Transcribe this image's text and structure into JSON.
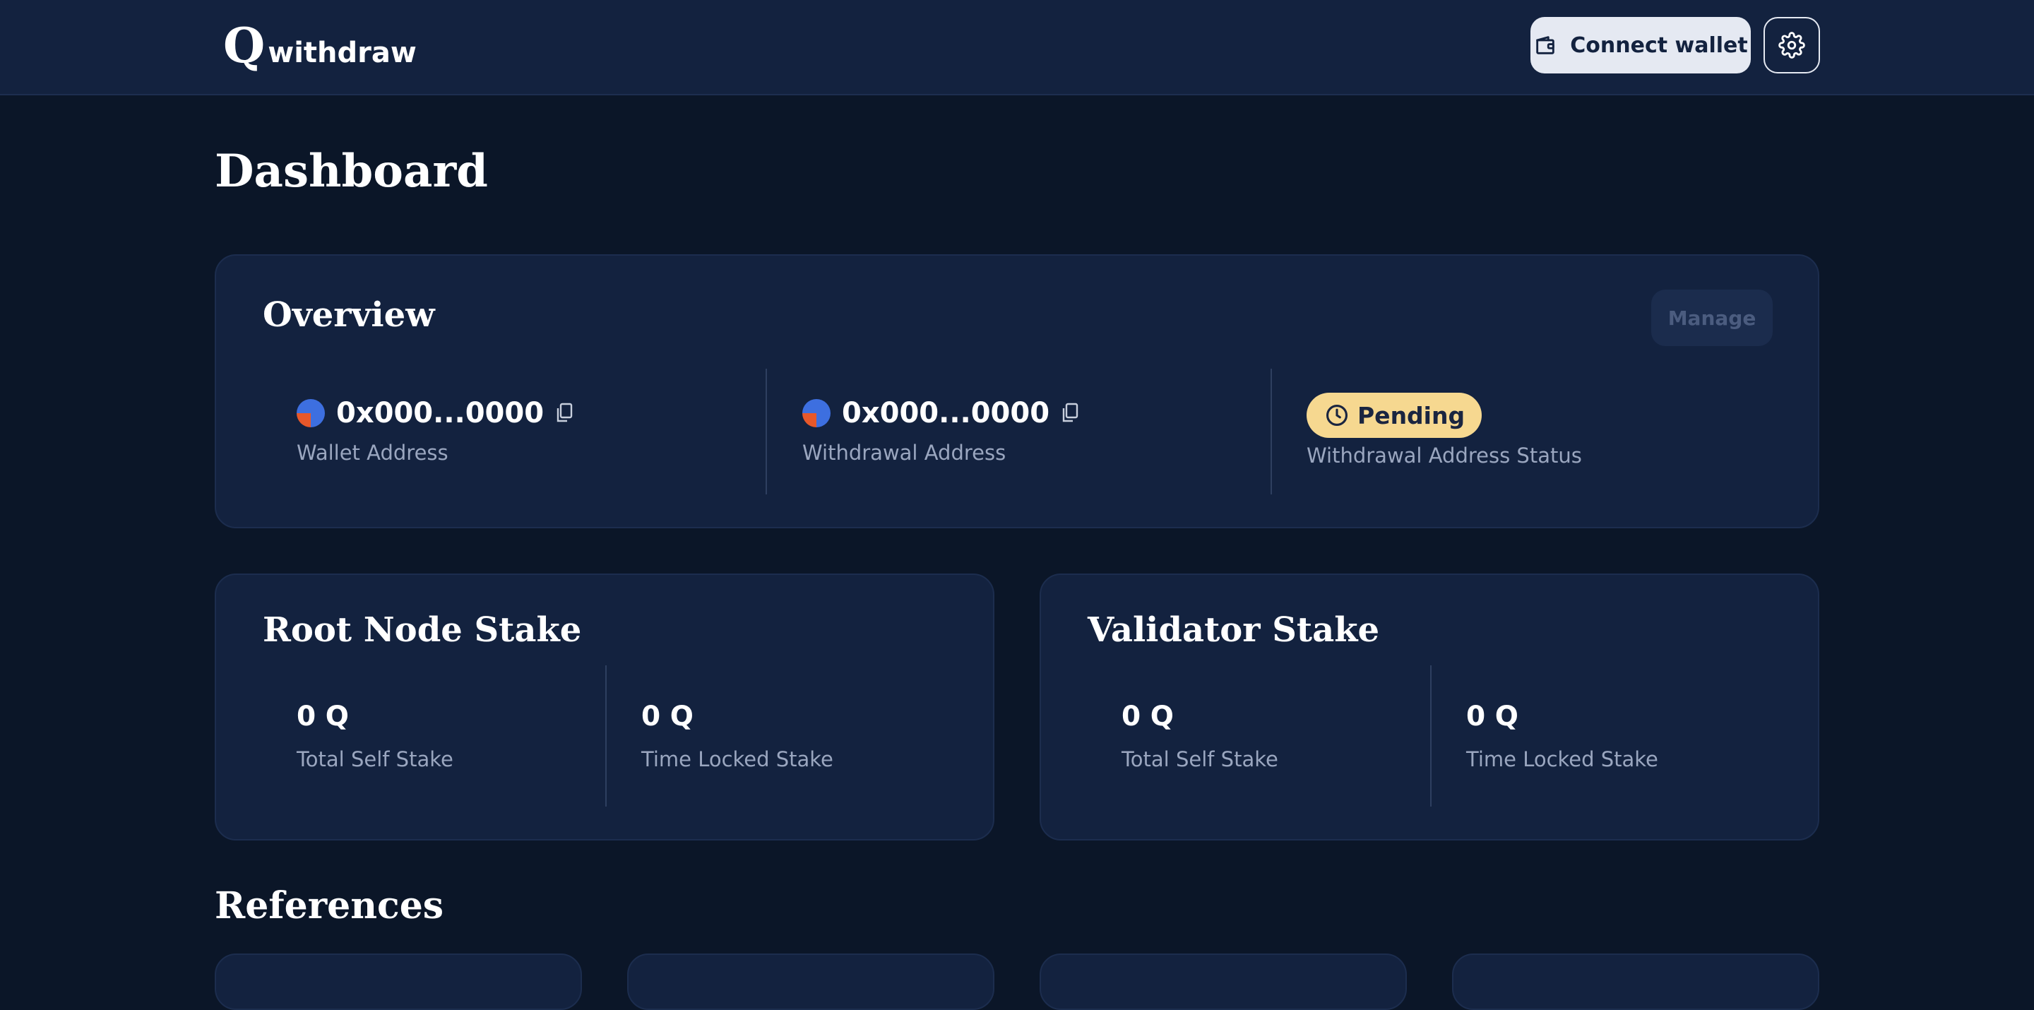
{
  "header": {
    "logo_letter": "Q",
    "logo_text": "withdraw",
    "connect_label": "Connect wallet"
  },
  "page": {
    "title": "Dashboard"
  },
  "overview": {
    "title": "Overview",
    "manage_label": "Manage",
    "wallet_address": "0x000...0000",
    "wallet_label": "Wallet Address",
    "withdrawal_address": "0x000...0000",
    "withdrawal_label": "Withdrawal Address",
    "status_value": "Pending",
    "status_label": "Withdrawal Address Status"
  },
  "root_node_stake": {
    "title": "Root Node Stake",
    "total_self_value": "0 Q",
    "total_self_label": "Total Self Stake",
    "time_locked_value": "0 Q",
    "time_locked_label": "Time Locked Stake"
  },
  "validator_stake": {
    "title": "Validator Stake",
    "total_self_value": "0 Q",
    "total_self_label": "Total Self Stake",
    "time_locked_value": "0 Q",
    "time_locked_label": "Time Locked Stake"
  },
  "references": {
    "title": "References"
  },
  "colors": {
    "background": "#0b1628",
    "card": "#13223f",
    "pending_badge": "#f6d890",
    "avatar_blue": "#3d6fe0",
    "avatar_orange": "#e7582a"
  },
  "icons": [
    "wallet-icon",
    "gear-icon",
    "copy-icon",
    "clock-icon"
  ]
}
